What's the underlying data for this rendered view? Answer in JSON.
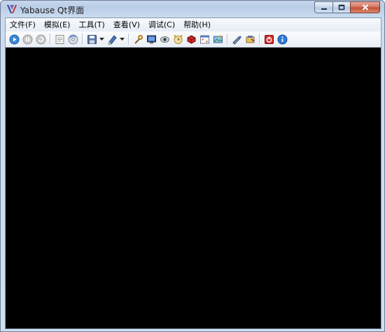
{
  "window": {
    "title": "Yabause Qt界面"
  },
  "menu": [
    {
      "id": "file",
      "label": "文件(F)"
    },
    {
      "id": "emulation",
      "label": "模拟(E)"
    },
    {
      "id": "tools",
      "label": "工具(T)"
    },
    {
      "id": "view",
      "label": "查看(V)"
    },
    {
      "id": "debug",
      "label": "调试(C)"
    },
    {
      "id": "help",
      "label": "帮助(H)"
    }
  ],
  "toolbar": {
    "icons": [
      "play-icon",
      "pause-icon",
      "reset-icon",
      "open-iso-icon",
      "open-cd-icon",
      "save-state-icon",
      "load-state-icon",
      "settings-icon",
      "vdp-icon",
      "cheats-icon",
      "frame-skip-icon",
      "memory-icon",
      "fullscreen-icon",
      "screenshot-icon",
      "layers-icon",
      "pad-icon",
      "power-icon",
      "about-icon"
    ]
  },
  "colors": {
    "screen": "#000000",
    "titlebar": "#b9cde7",
    "menubar": "#edf1f7"
  }
}
